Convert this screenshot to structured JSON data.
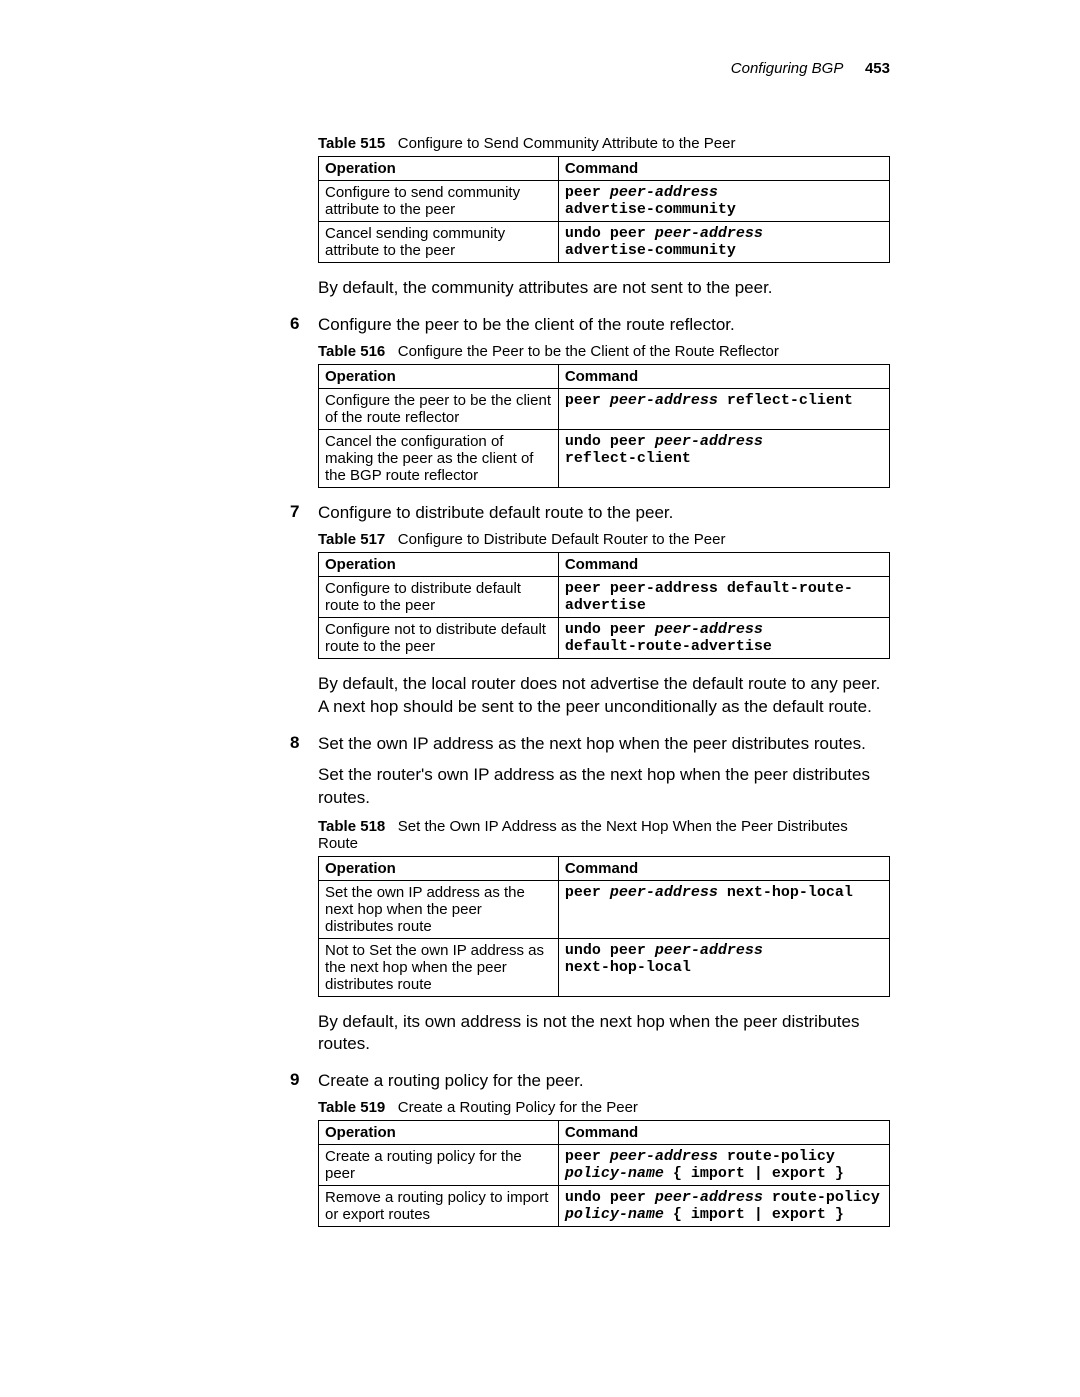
{
  "header": {
    "section": "Configuring BGP",
    "page": "453"
  },
  "t515": {
    "label": "Table 515",
    "caption": "Configure to Send Community Attribute to the Peer",
    "h_op": "Operation",
    "h_cmd": "Command",
    "r1_op": "Configure to send community attribute to the peer",
    "r1_cmd_k1": "peer",
    "r1_cmd_a1": "peer-address",
    "r1_cmd_k2": "advertise-community",
    "r2_op": "Cancel sending community attribute to the peer",
    "r2_cmd_k1": "undo peer",
    "r2_cmd_a1": "peer-address",
    "r2_cmd_k2": "advertise-community"
  },
  "p_after_515": "By default, the community attributes are not sent to the peer.",
  "step6": {
    "num": "6",
    "text": "Configure the peer to be the client of the route reflector."
  },
  "t516": {
    "label": "Table 516",
    "caption": "Configure the Peer to be the Client of the Route Reflector",
    "h_op": "Operation",
    "h_cmd": "Command",
    "r1_op": "Configure the peer to be the client of the route reflector",
    "r1_cmd_k1": "peer",
    "r1_cmd_a1": "peer-address",
    "r1_cmd_k2": "reflect-client",
    "r2_op": "Cancel the configuration of making the peer as the client of the BGP route reflector",
    "r2_cmd_k1": "undo peer",
    "r2_cmd_a1": "peer-address",
    "r2_cmd_k2": "reflect-client"
  },
  "step7": {
    "num": "7",
    "text": "Configure to distribute default route to the peer."
  },
  "t517": {
    "label": "Table 517",
    "caption": "Configure to Distribute Default Router to the Peer",
    "h_op": "Operation",
    "h_cmd": "Command",
    "r1_op": "Configure to distribute default route to the peer",
    "r1_cmd_k1": "peer peer-address default-route-advertise",
    "r2_op": "Configure not to distribute default route to the peer",
    "r2_cmd_k1": "undo peer",
    "r2_cmd_a1": "peer-address",
    "r2_cmd_k2": "default-route-advertise"
  },
  "p_after_517": "By default, the local router does not advertise the default route to any peer. A next hop should be sent to the peer unconditionally as the default route.",
  "step8": {
    "num": "8",
    "text": "Set the own IP address as the next hop when the peer distributes routes."
  },
  "p_step8_body": "Set the router's own IP address as the next hop when the peer distributes routes.",
  "t518": {
    "label": "Table 518",
    "caption": "Set the Own IP Address as the Next Hop When the Peer Distributes Route",
    "h_op": "Operation",
    "h_cmd": "Command",
    "r1_op": "Set the own IP address as the next hop when the peer distributes route",
    "r1_cmd_k1": "peer",
    "r1_cmd_a1": "peer-address",
    "r1_cmd_k2": "next-hop-local",
    "r2_op": "Not to Set the own IP address as the next hop when the peer distributes route",
    "r2_cmd_k1": "undo peer",
    "r2_cmd_a1": "peer-address",
    "r2_cmd_k2": "next-hop-local"
  },
  "p_after_518": "By default, its own address is not the next hop when the peer distributes routes.",
  "step9": {
    "num": "9",
    "text": "Create a routing policy for the peer."
  },
  "t519": {
    "label": "Table 519",
    "caption": "Create a Routing Policy for the Peer",
    "h_op": "Operation",
    "h_cmd": "Command",
    "r1_op": "Create a routing policy for the peer",
    "r1_cmd_k1": "peer",
    "r1_cmd_a1": "peer-address",
    "r1_cmd_k2": "route-policy",
    "r1_cmd_a2": "policy-name",
    "r1_cmd_k3": "{ import | export }",
    "r2_op": "Remove a routing policy to import or export routes",
    "r2_cmd_k1": "undo peer",
    "r2_cmd_a1": "peer-address",
    "r2_cmd_k2": "route-policy",
    "r2_cmd_a2": "policy-name",
    "r2_cmd_k3": "{ import | export }"
  }
}
